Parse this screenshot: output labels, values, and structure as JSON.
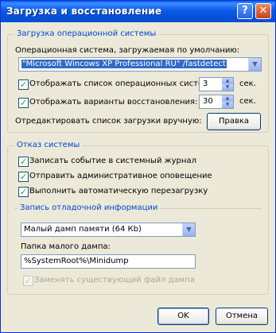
{
  "window": {
    "title": "Загрузка и восстановление",
    "help_glyph": "?",
    "close_glyph": "✕"
  },
  "os_group": {
    "legend": "Загрузка операционной системы",
    "default_os_label": "Операционная система, загружаемая по умолчанию:",
    "default_os_value": "\"Microsoft Wincows XP Professional RU\" /fastdetect",
    "show_list": {
      "label": "Отображать список операционных систем:",
      "checked": true,
      "value": "3",
      "unit": "сек."
    },
    "show_recovery": {
      "label": "Отображать варианты восстановления:",
      "checked": true,
      "value": "30",
      "unit": "сек."
    },
    "edit_label": "Отредактировать список загрузки вручную:",
    "edit_button": "Правка"
  },
  "failure_group": {
    "legend": "Отказ системы",
    "write_event": {
      "label": "Записать событие в системный журнал",
      "checked": true
    },
    "send_alert": {
      "label": "Отправить административное оповещение",
      "checked": true
    },
    "auto_restart": {
      "label": "Выполнить автоматическую перезагрузку",
      "checked": true
    }
  },
  "debug_group": {
    "legend": "Запись отладочной информации",
    "dump_type": "Малый дамп памяти (64 Кb)",
    "folder_label": "Папка малого дампа:",
    "folder_value": "%SystemRoot%\\Minidump",
    "overwrite": {
      "label": "Заменять существующий файл дампа",
      "checked": true,
      "enabled": false
    }
  },
  "buttons": {
    "ok": "OK",
    "cancel": "Отмена"
  },
  "check_glyph": "✓",
  "arrow_down_glyph": "▼",
  "arrow_up_glyph": "▲"
}
